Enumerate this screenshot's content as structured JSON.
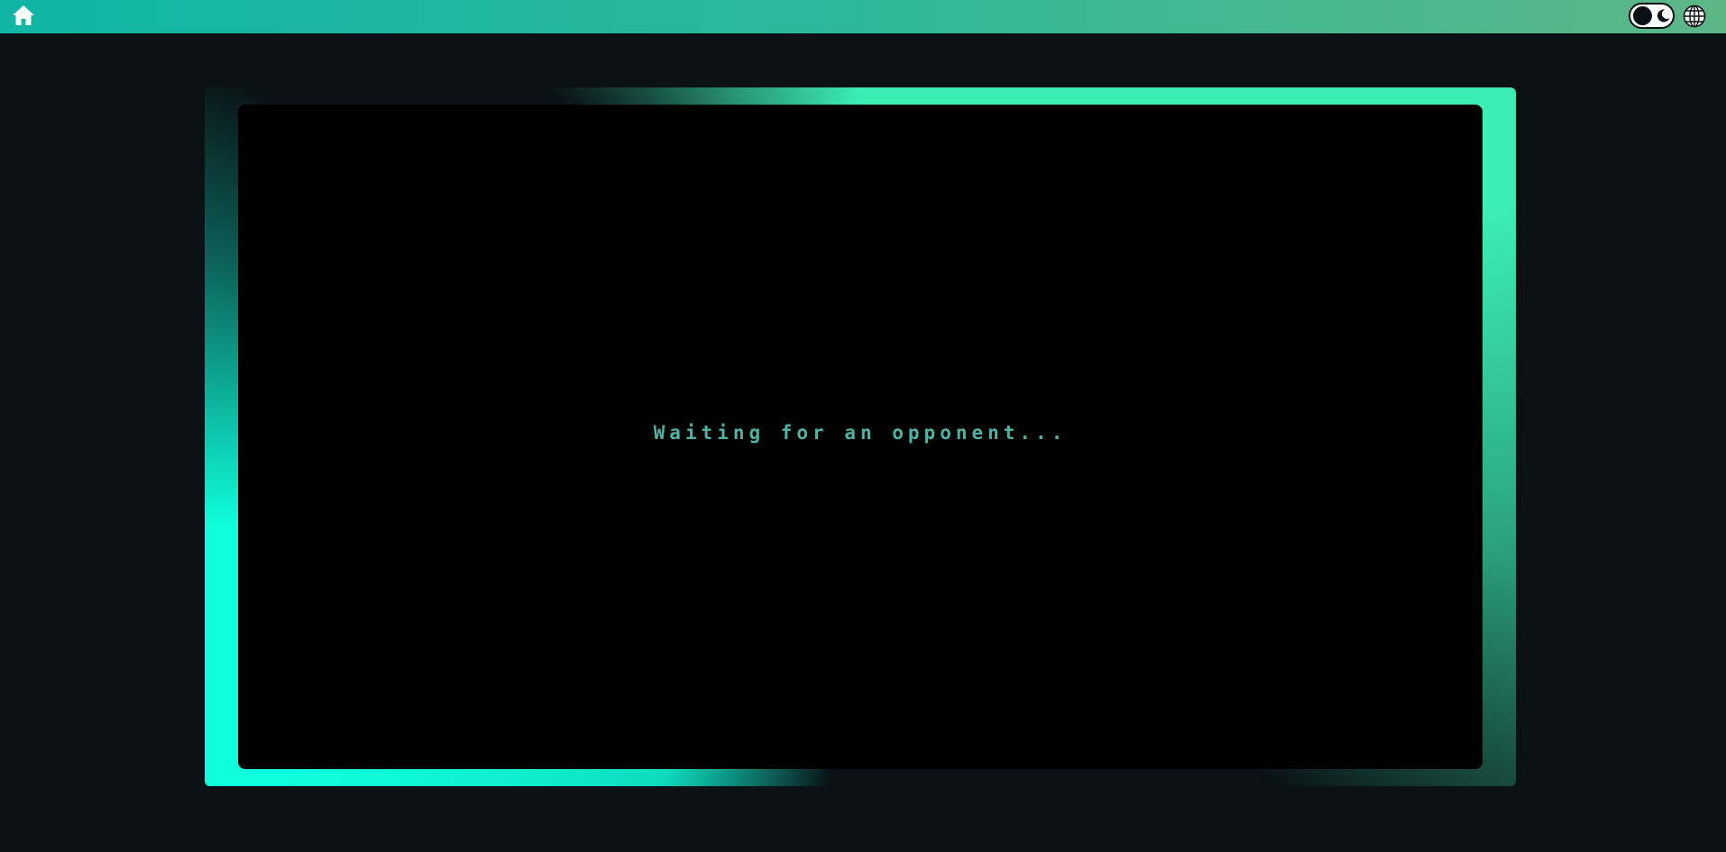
{
  "header": {
    "home_icon": "home-icon",
    "theme_toggle": {
      "state": "dark",
      "icon": "moon-icon"
    },
    "language_icon": "globe-icon"
  },
  "game": {
    "status": "Waiting for an opponent..."
  },
  "colors": {
    "background": "#0a1115",
    "header_start": "#0fb5a5",
    "header_end": "#5db787",
    "frame_glow_top": "#3ceeb4",
    "frame_glow_bottom": "#0fffdc",
    "board": "#000000",
    "status_text": "#4fb3a4"
  }
}
